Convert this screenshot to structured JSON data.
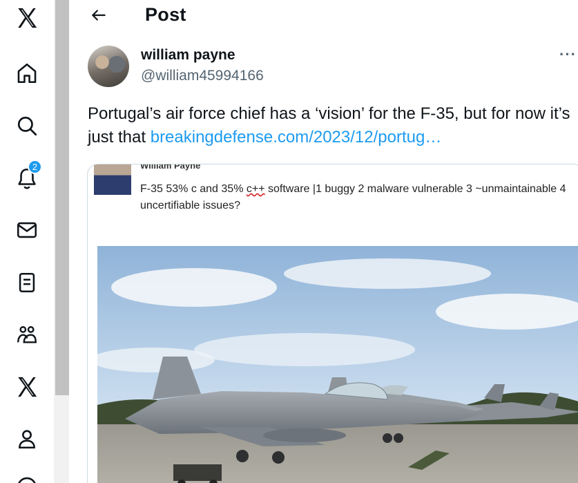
{
  "header": {
    "title": "Post"
  },
  "nav": {
    "notifications_badge": "2"
  },
  "post": {
    "author_name": "william payne",
    "author_handle": "@william45994166",
    "more_label": "···",
    "text": "Portugal’s air force chief has a ‘vision’ for the F-35, but for now it’s just that ",
    "link_text": "breakingdefense.com/2023/12/portug…"
  },
  "media": {
    "inner_author": "William Payne",
    "inner_text_a": "F-35 53% c and 35% ",
    "inner_text_cpp": "c++",
    "inner_text_b": " software |1 buggy 2 malware vulnerable 3 ~unmaintainable 4 uncertifiable issues?"
  },
  "colors": {
    "accent": "#1d9bf0",
    "text": "#0f1419",
    "secondary": "#536471"
  }
}
